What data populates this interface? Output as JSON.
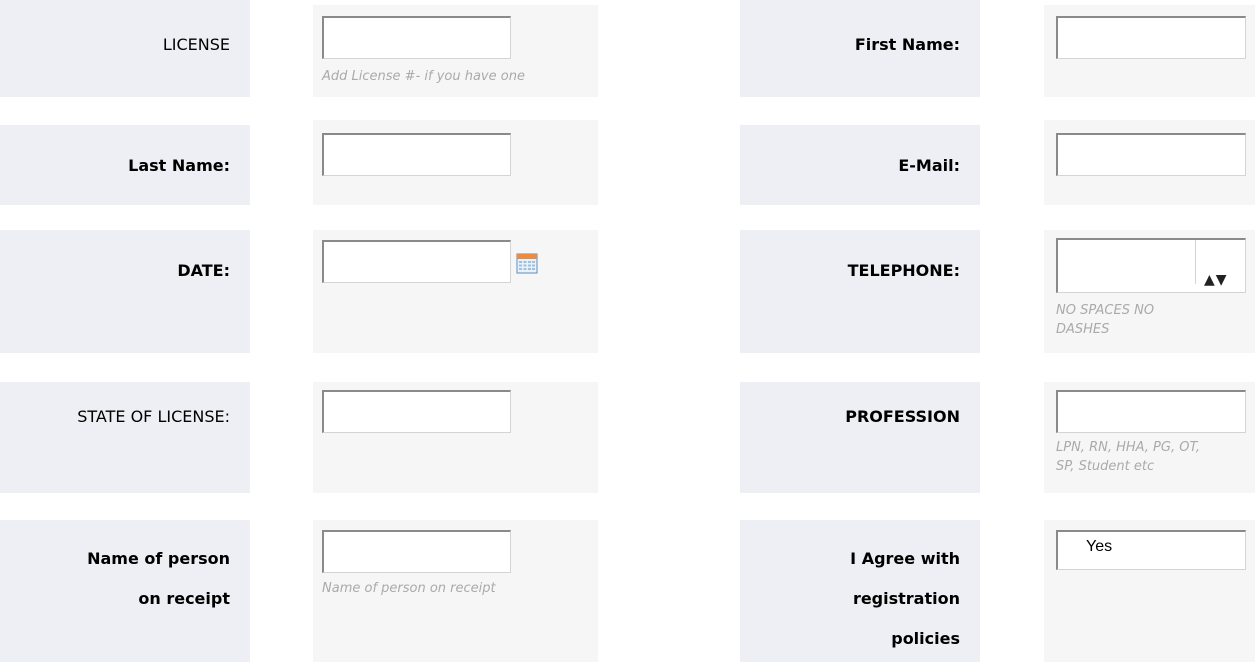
{
  "fields": {
    "license": {
      "label": "LICENSE",
      "value": "",
      "hint": "Add License #- if you have one"
    },
    "first_name": {
      "label": "First Name:",
      "value": ""
    },
    "last_name": {
      "label": "Last Name:",
      "value": ""
    },
    "email": {
      "label": "E-Mail:",
      "value": ""
    },
    "date": {
      "label": "DATE:",
      "value": "",
      "icon": "calendar-icon"
    },
    "telephone": {
      "label": "TELEPHONE:",
      "value": "",
      "hint_line1": "NO SPACES NO",
      "hint_line2": "DASHES",
      "spinner": "▲▼"
    },
    "state_of_license": {
      "label": "STATE OF LICENSE:",
      "value": ""
    },
    "profession": {
      "label": "PROFESSION",
      "value": "",
      "hint_line1": "LPN, RN, HHA, PG, OT,",
      "hint_line2": "SP, Student etc"
    },
    "receipt_name": {
      "label_line1": "Name of person",
      "label_line2": "on receipt",
      "value": "",
      "hint": "Name of person on receipt"
    },
    "agree": {
      "label_line1": "I Agree with",
      "label_line2": "registration",
      "label_line3": "policies",
      "value": "Yes"
    }
  },
  "colors": {
    "label_bg": "#eeeff4",
    "field_bg": "#f6f6f6",
    "hint": "#aaaaaa"
  }
}
